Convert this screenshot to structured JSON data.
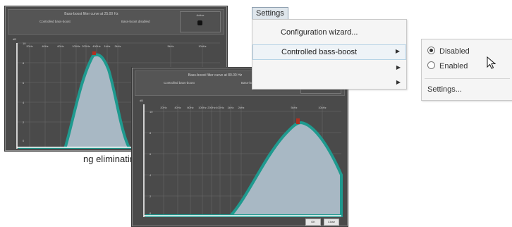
{
  "left_panel": {
    "title": "Bass-boost filter curve at 25.00 Hz",
    "left_label": "Controlled bass-boost",
    "right_label": "Bass-boost disabled",
    "box_label": "Active",
    "ylabel": "dB",
    "x_ticks": [
      "20Hz",
      "40Hz",
      "60Hz",
      "100Hz",
      "200Hz",
      "400Hz",
      "1kHz",
      "2kHz",
      "5kHz",
      "10kHz"
    ],
    "y_ticks": [
      "10",
      "8",
      "6",
      "4",
      "2",
      "0"
    ]
  },
  "right_panel": {
    "title": "Bass-boost filter curve at 80.00 Hz",
    "left_label": "Controlled bass-boost",
    "right_label": "Bass-boost enabled",
    "box_label": "Active",
    "ylabel": "dB",
    "x_ticks": [
      "20Hz",
      "40Hz",
      "60Hz",
      "100Hz",
      "200Hz",
      "400Hz",
      "1kHz",
      "2kHz",
      "5kHz",
      "10kHz"
    ],
    "y_ticks": [
      "10",
      "8",
      "6",
      "4",
      "2",
      "0"
    ],
    "buttons": [
      "OK",
      "Close"
    ]
  },
  "fragment_text": "ng eliminating",
  "menu": {
    "root_label": "Settings",
    "items": [
      {
        "label": "Configuration wizard...",
        "has_submenu": false
      },
      {
        "label": "Controlled bass-boost",
        "has_submenu": true,
        "highlighted": true
      },
      {
        "label": "",
        "has_submenu": true
      },
      {
        "label": "",
        "has_submenu": true
      }
    ],
    "submenu": {
      "options": [
        {
          "label": "Disabled",
          "selected": true
        },
        {
          "label": "Enabled",
          "selected": false
        }
      ],
      "settings_label": "Settings..."
    }
  },
  "colors": {
    "panel_bg": "#4a4a4a",
    "curve_fill": "#a8b8c4",
    "curve_stroke": "#1f9a8f",
    "peak_marker": "#b03020"
  }
}
